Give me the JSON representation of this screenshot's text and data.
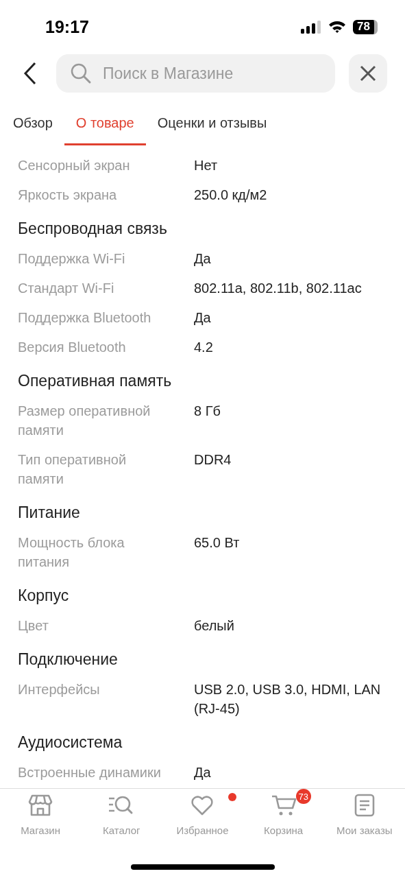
{
  "status_bar": {
    "time": "19:17",
    "battery": "78"
  },
  "search": {
    "placeholder": "Поиск в Магазине"
  },
  "tabs": [
    {
      "label": "Обзор",
      "selected": false
    },
    {
      "label": "О товаре",
      "selected": true
    },
    {
      "label": "Оценки и отзывы",
      "selected": false
    }
  ],
  "sections": [
    {
      "items": [
        {
          "label": "Сенсорный экран",
          "value": "Нет"
        },
        {
          "label": "Яркость экрана",
          "value": "250.0 кд/м2"
        }
      ]
    },
    {
      "title": "Беспроводная связь",
      "items": [
        {
          "label": "Поддержка Wi-Fi",
          "value": "Да"
        },
        {
          "label": "Стандарт Wi-Fi",
          "value": "802.11a, 802.11b, 802.11ac"
        },
        {
          "label": "Поддержка Bluetooth",
          "value": "Да"
        },
        {
          "label": "Версия Bluetooth",
          "value": "4.2"
        }
      ]
    },
    {
      "title": "Оперативная память",
      "items": [
        {
          "label": "Размер оперативной памяти",
          "value": "8 Гб"
        },
        {
          "label": "Тип оперативной памяти",
          "value": "DDR4"
        }
      ]
    },
    {
      "title": "Питание",
      "items": [
        {
          "label": "Мощность блока питания",
          "value": "65.0 Вт"
        }
      ]
    },
    {
      "title": "Корпус",
      "items": [
        {
          "label": "Цвет",
          "value": "белый"
        }
      ]
    },
    {
      "title": "Подключение",
      "items": [
        {
          "label": "Интерфейсы",
          "value": "USB 2.0, USB 3.0, HDMI, LAN (RJ-45)"
        }
      ]
    },
    {
      "title": "Аудиосистема",
      "items": [
        {
          "label": "Встроенные динамики",
          "value": "Да"
        }
      ]
    }
  ],
  "nav": [
    {
      "kind": "store",
      "label": "Магазин",
      "dot": false
    },
    {
      "kind": "catalog",
      "label": "Каталог",
      "dot": false
    },
    {
      "kind": "heart",
      "label": "Избранное",
      "dot": true
    },
    {
      "kind": "cart",
      "label": "Корзина",
      "dot": false,
      "badge": "73"
    },
    {
      "kind": "orders",
      "label": "Мои заказы",
      "dot": false
    }
  ]
}
